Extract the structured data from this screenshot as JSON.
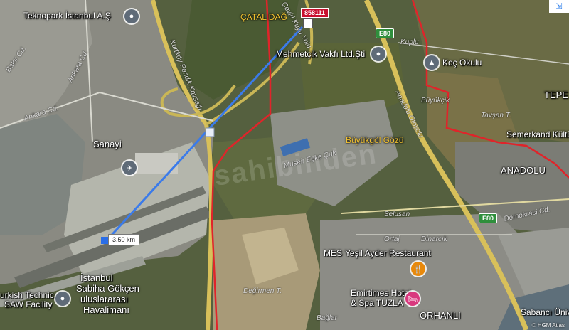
{
  "map": {
    "poi_labels": {
      "teknopark": "Teknopark İstanbul A.Ş",
      "mehmetcik": "Mehmetçik Vakfı Ltd.Şti",
      "koc": "Koç Okulu",
      "semerkand": "Semerkand Kültü",
      "yesil_ayder": "Yeşil Ayder Restaurant",
      "mes": "MES",
      "emirtimes_1": "Emirtimes Hotel",
      "emirtimes_2": "& Spa TUZLA",
      "sabanci": "Sabancı Ünive",
      "turkish_technic_1": "urkish Technic",
      "turkish_technic_2": "SAW Facility"
    },
    "area_labels": {
      "catal_dag": "ÇATAL DAĞ",
      "buyukgol": "Büyükgöl Gözü",
      "sanayi": "Sanayi",
      "anadolu": "ANADOLU",
      "tepe": "TEPE",
      "orhanli": "ORHANLI",
      "airport_1": "İstanbul",
      "airport_2": "Sabiha Gökçen",
      "airport_3": "uluslararası",
      "airport_4": "Havalimanı"
    },
    "road_labels": {
      "ankara_cd_1": "Ankara Cd.",
      "ankara_cd_2": "Ankara Cd.",
      "bakir_cd": "Bakır Cd.",
      "anadolu_otoyolu": "Anadolu Otoyolu",
      "demokrasi_cd": "Demokrasi Cd.",
      "kuplu": "Kuplu",
      "tavsan_t": "Tavşan T.",
      "selusan": "Selusan",
      "ortaj": "Ortaj",
      "degirmen_t": "Değirmen T.",
      "baglar": "Bağlar",
      "museir": "Museir Eşke Çuk",
      "pendik_kavsagi": "Kurtköy Pendik Kavşağı",
      "ceviri_kuyu": "Çeviri Kuyu Yolu",
      "dinarcik": "Dinarcık",
      "buyukcik": "Büyükçik"
    },
    "shields": {
      "e80_top": "E80",
      "e80_bottom": "E80"
    },
    "marker_label": "858111",
    "distance_label": "3,50 km",
    "watermark": "sahibinden",
    "attribution": "© HGM Atlas",
    "top_right_control": "⇲"
  }
}
